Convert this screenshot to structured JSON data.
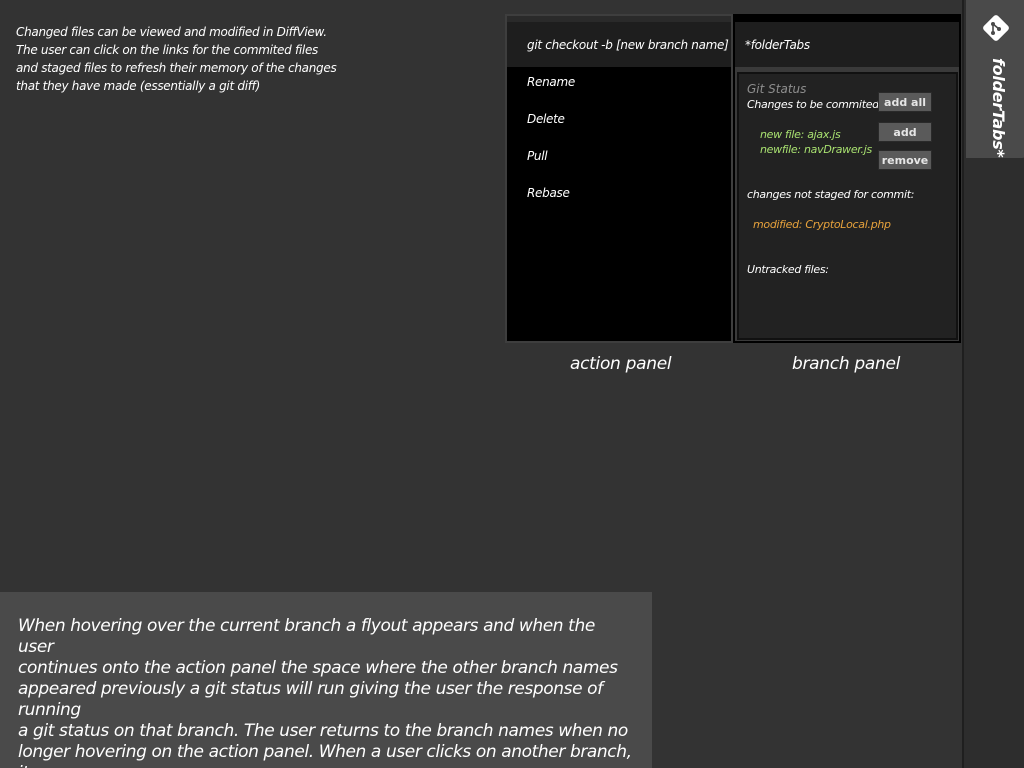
{
  "notes": {
    "top": "Changed files can be viewed and modified in DiffView.\nThe user can click on the links for the commited files\nand staged files to refresh their memory of the changes\nthat they have made (essentially a git diff)",
    "bottom": "When hovering over the current branch a flyout appears and when the user\ncontinues onto the action panel the space where the other branch names\nappeared previously a git status will run giving the user the response of running\na git status on that branch. The user returns to the branch names when no\nlonger hovering on the action panel.  When a user clicks on another branch, it\nchecks that branch out, and behavior follows as expected."
  },
  "action_panel": {
    "caption": "action panel",
    "current": "git checkout -b [new branch name]",
    "items": [
      "Rename",
      "Delete",
      "Pull",
      "Rebase"
    ]
  },
  "branch_panel": {
    "caption": "branch panel",
    "current_branch": "*folderTabs",
    "git_status": {
      "title": "Git Status",
      "to_be_committed_label": "Changes to be commited:",
      "committed_files": [
        "new file:  ajax.js",
        "newfile: navDrawer.js"
      ],
      "not_staged_label": "changes not staged for commit:",
      "modified_files": [
        "modified:  CryptoLocal.php"
      ],
      "untracked_label": "Untracked files:",
      "buttons": {
        "add_all": "add all",
        "add": "add",
        "remove": "remove"
      }
    }
  },
  "side_tab": {
    "label": "folderTabs*",
    "icon": "git-icon"
  },
  "colors": {
    "committed_file": "#a8e070",
    "modified_file": "#e7a23c"
  }
}
